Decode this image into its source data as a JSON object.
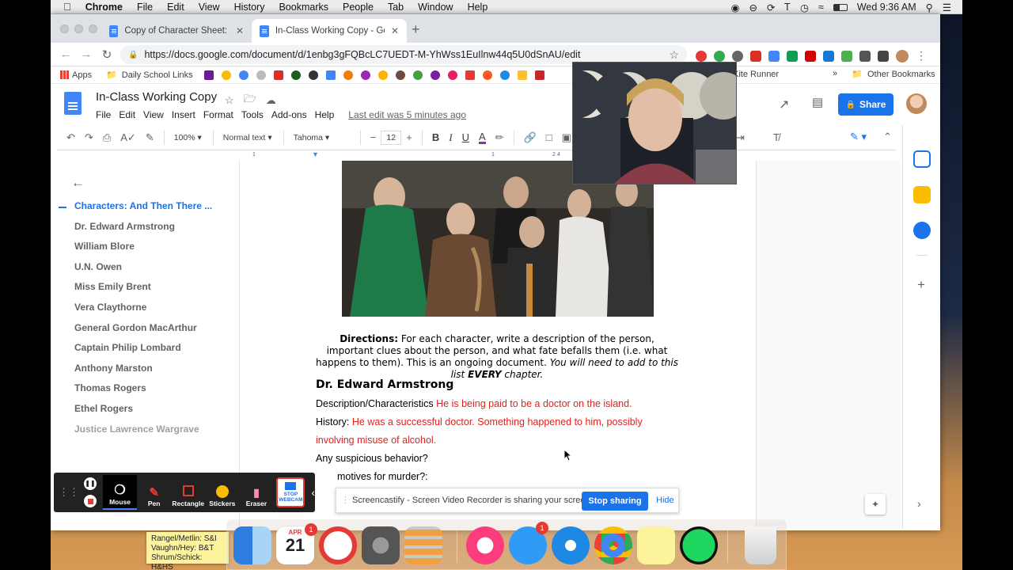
{
  "menubar": {
    "app": "Chrome",
    "items": [
      "File",
      "Edit",
      "View",
      "History",
      "Bookmarks",
      "People",
      "Tab",
      "Window",
      "Help"
    ],
    "clock": "Wed 9:36 AM"
  },
  "tabs": [
    {
      "title": "Copy of Character Sheet: And",
      "active": false
    },
    {
      "title": "In-Class Working Copy - Goog",
      "active": true
    }
  ],
  "address": {
    "url": "https://docs.google.com/document/d/1enbg3gFQBcLC7UEDT-M-YhWss1EuIlnw44q5U0dSnAU/edit"
  },
  "bookmarks": {
    "apps": "Apps",
    "daily": "Daily School Links",
    "kite": "Kite Runner",
    "more": "»",
    "other": "Other Bookmarks"
  },
  "docs": {
    "title": "In-Class Working Copy",
    "menu": [
      "File",
      "Edit",
      "View",
      "Insert",
      "Format",
      "Tools",
      "Add-ons",
      "Help"
    ],
    "last_edit": "Last edit was 5 minutes ago",
    "share": "Share"
  },
  "toolbar": {
    "zoom": "100%",
    "style": "Normal text",
    "font": "Tahoma",
    "size": "12"
  },
  "ruler": [
    "1",
    "1",
    "2",
    "3",
    "4"
  ],
  "outline": {
    "items": [
      "Characters: And Then There ...",
      "Dr. Edward Armstrong",
      "William Blore",
      "U.N. Owen",
      "Miss Emily Brent",
      "Vera Claythorne",
      "General Gordon MacArthur",
      "Captain Philip Lombard",
      "Anthony Marston",
      "Thomas Rogers",
      "Ethel Rogers",
      "Justice Lawrence Wargrave"
    ]
  },
  "content": {
    "directions_label": "Directions:",
    "directions_1": " For each character, write a description of the person, important clues about the person, and what fate befalls them (i.e. what happens to them). This is an ongoing document. ",
    "directions_2": "You will need to add to this list ",
    "directions_3": "EVERY",
    "directions_4": " chapter.",
    "heading": "Dr. Edward Armstrong",
    "desc_label": "Description/Characteristics ",
    "desc_value": "He is being paid to be a doctor on the island.",
    "history_label": " History: ",
    "history_value_1": "He was a successful doctor. Something happened to him, possibly",
    "history_value_2": "involving misuse of alcohol.",
    "suspicious": "Any suspicious behavior?",
    "motives": "motives for murder?:"
  },
  "screencastify": {
    "buttons": [
      "Mouse",
      "Pen",
      "Rectangle",
      "Stickers",
      "Eraser"
    ],
    "webcam_1": "STOP",
    "webcam_2": "WEBCAM",
    "sharing": "Screencastify - Screen Video Recorder is sharing your screen.",
    "stop": "Stop sharing",
    "hide": "Hide"
  },
  "dock": {
    "calendar_month": "APR",
    "calendar_day": "21",
    "calendar_badge": "1",
    "messages_badge": "1"
  },
  "sticky": {
    "line1": "Rangel/Metlin: S&I",
    "line2": "Vaughn/Hey: B&T",
    "line3": "Shrum/Schick: H&HS"
  },
  "colors": {
    "docs_blue": "#1a73e8",
    "answer_red": "#e0221f"
  }
}
